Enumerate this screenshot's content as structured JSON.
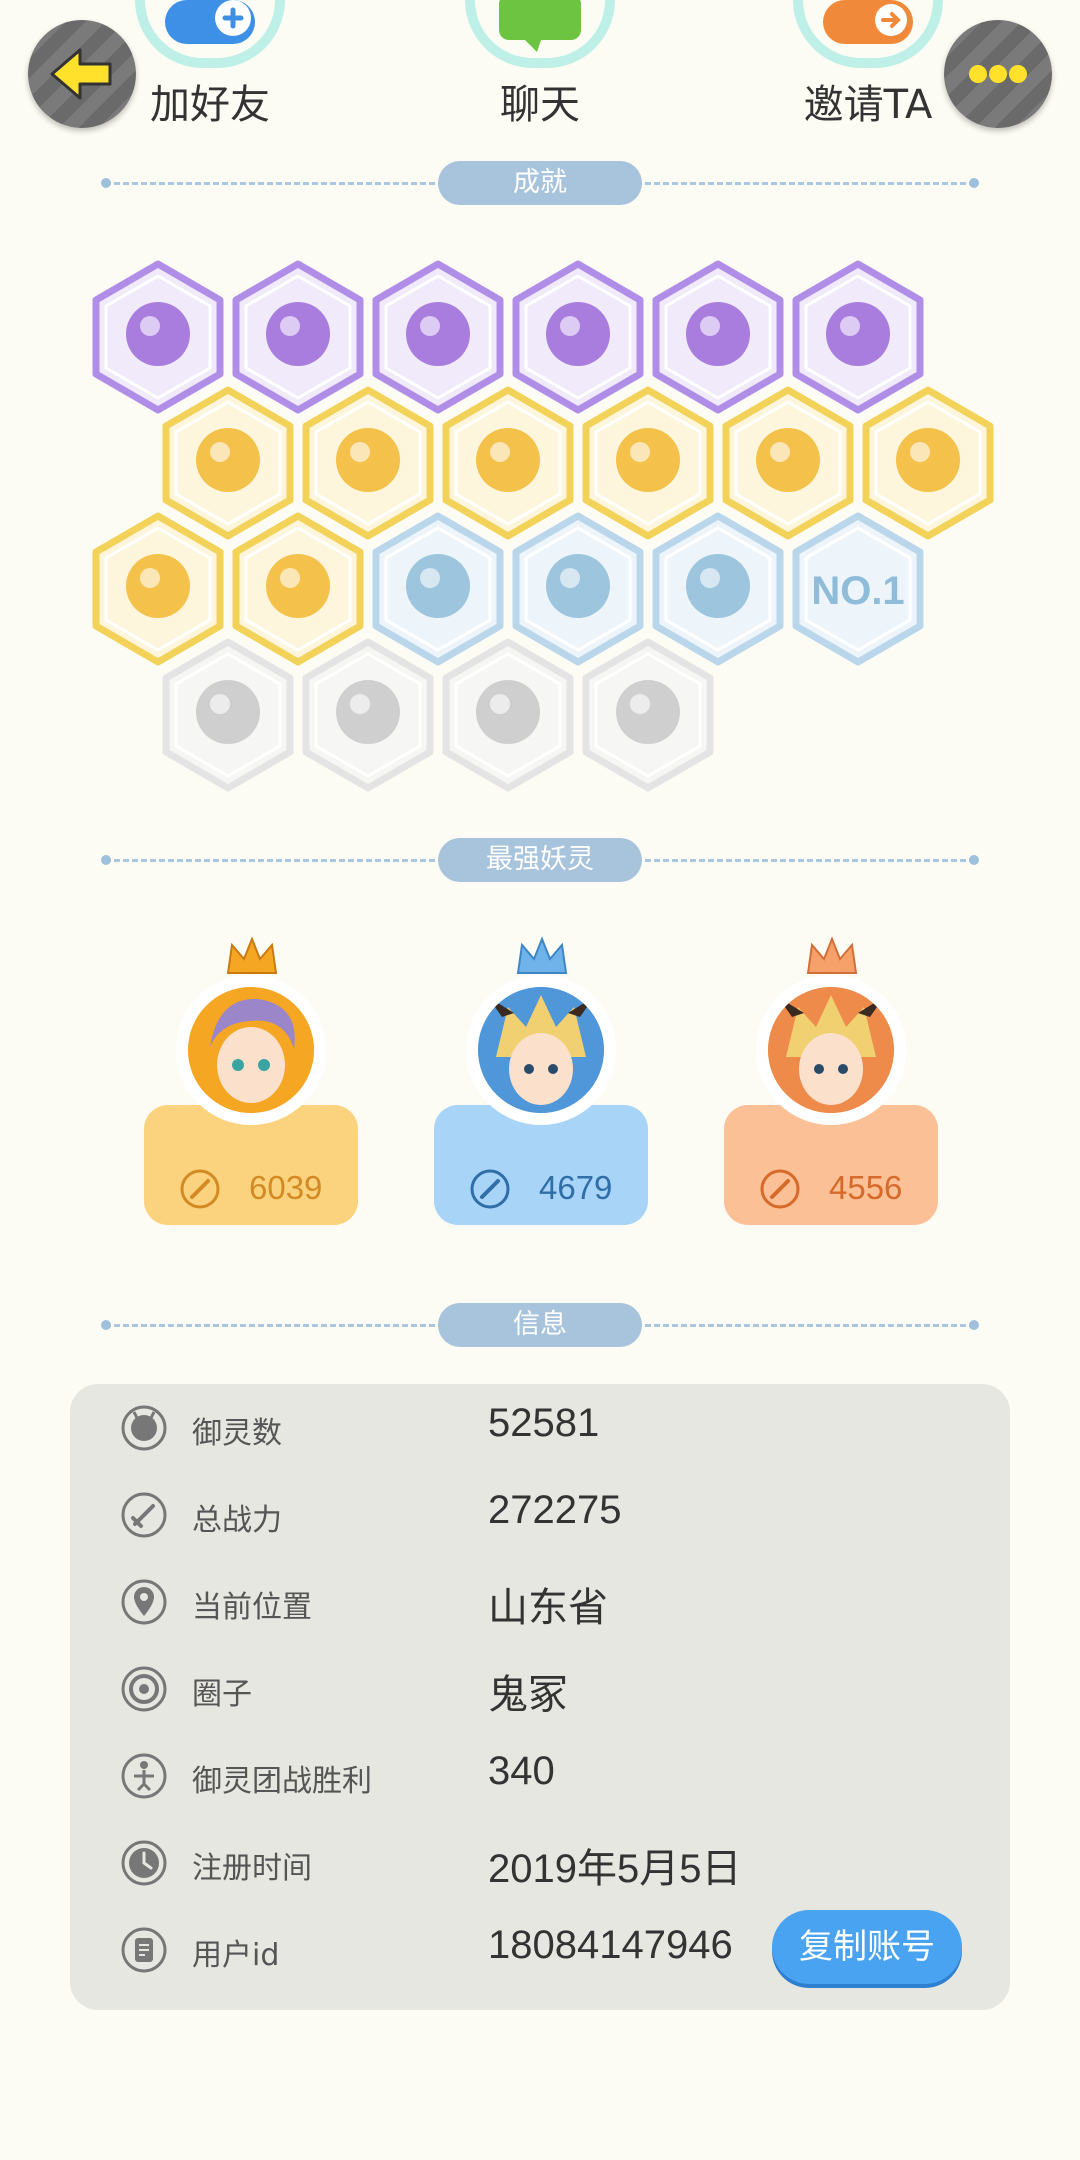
{
  "top_actions": {
    "add_friend": "加好友",
    "chat": "聊天",
    "invite": "邀请TA"
  },
  "colors": {
    "background": "#fdfcf4",
    "section_pill": "#a7c4dc",
    "copy_button": "#4aa3f0",
    "info_panel": "#e7e7e1"
  },
  "sections": {
    "achievements": "成就",
    "strongest": "最强妖灵",
    "info": "信息"
  },
  "achievements": [
    {
      "tier": "purple",
      "icon": "shoe-icon"
    },
    {
      "tier": "purple",
      "icon": "eye-orb-icon"
    },
    {
      "tier": "purple",
      "icon": "demon-icon"
    },
    {
      "tier": "purple",
      "icon": "crystal-ball-icon"
    },
    {
      "tier": "purple",
      "icon": "meteor-icon"
    },
    {
      "tier": "purple",
      "icon": "cat-icon"
    },
    {
      "tier": "gold",
      "icon": "moon-sun-icon"
    },
    {
      "tier": "gold",
      "icon": "crystal-icon"
    },
    {
      "tier": "gold",
      "icon": "yin-yang-icon"
    },
    {
      "tier": "gold",
      "icon": "fish-icon"
    },
    {
      "tier": "gold",
      "icon": "shield-icon"
    },
    {
      "tier": "gold",
      "icon": "beast-icon"
    },
    {
      "tier": "gold",
      "icon": "book-icon"
    },
    {
      "tier": "gold",
      "icon": "angry-face-icon"
    },
    {
      "tier": "blue",
      "icon": "spirit-icon"
    },
    {
      "tier": "blue",
      "icon": "stroller-icon"
    },
    {
      "tier": "blue",
      "icon": "monster-icon"
    },
    {
      "tier": "blue",
      "icon": "no1-icon",
      "label": "NO.1"
    },
    {
      "tier": "gray",
      "icon": "badge-icon"
    },
    {
      "tier": "gray",
      "icon": "swords-icon"
    },
    {
      "tier": "gray",
      "icon": "hearts-icon"
    },
    {
      "tier": "gray",
      "icon": "list-icon"
    }
  ],
  "top_spirits": [
    {
      "power": "6039",
      "theme": "gold"
    },
    {
      "power": "4679",
      "theme": "blue"
    },
    {
      "power": "4556",
      "theme": "orange"
    }
  ],
  "info": {
    "rows": [
      {
        "label": "御灵数",
        "value": "52581",
        "icon": "spirit-count-icon"
      },
      {
        "label": "总战力",
        "value": "272275",
        "icon": "sword-icon"
      },
      {
        "label": "当前位置",
        "value": "山东省",
        "icon": "location-icon"
      },
      {
        "label": "圈子",
        "value": "鬼冢",
        "icon": "circle-icon"
      },
      {
        "label": "御灵团战胜利",
        "value": "340",
        "icon": "team-icon"
      },
      {
        "label": "注册时间",
        "value": "2019年5月5日",
        "icon": "clock-icon"
      },
      {
        "label": "用户id",
        "value": "18084147946",
        "icon": "id-icon"
      }
    ],
    "copy_button": "复制账号"
  }
}
